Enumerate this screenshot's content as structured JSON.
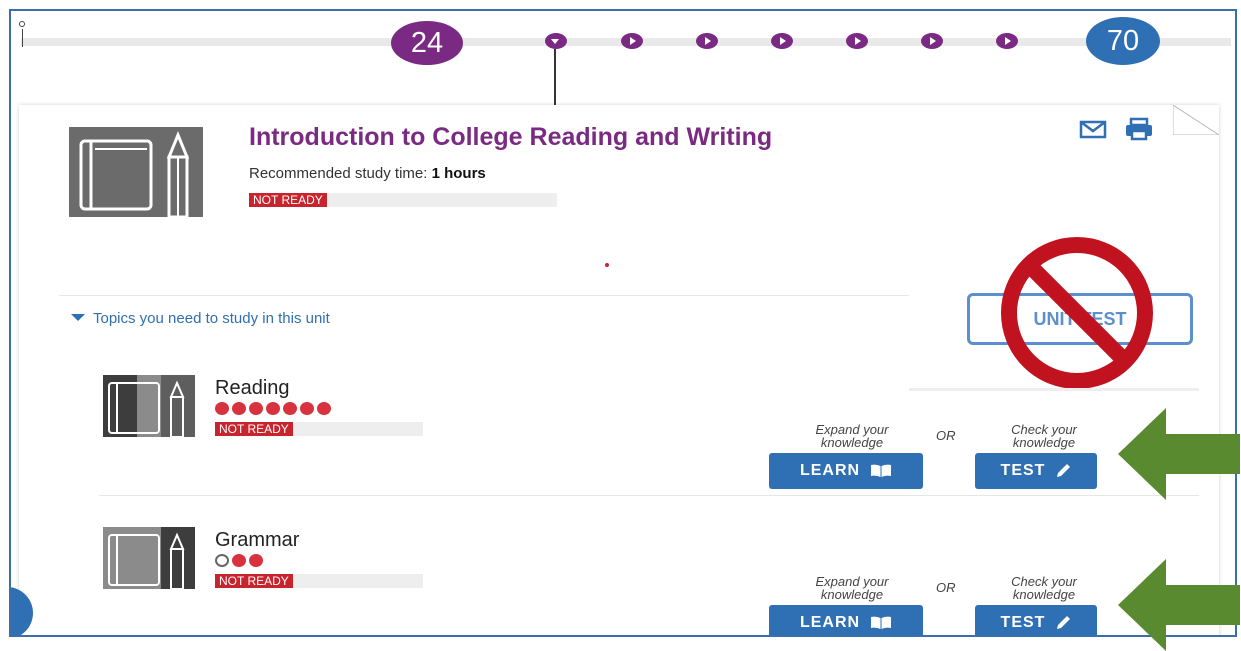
{
  "timeline": {
    "start_node": "24",
    "end_node": "70"
  },
  "unit": {
    "title": "Introduction to College Reading and Writing",
    "study_label": "Recommended study time:",
    "study_value": "1 hours",
    "status": "NOT READY"
  },
  "unit_test": {
    "label": "UNIT TEST",
    "blocked_icon": "prohibited-icon"
  },
  "topics_header": "Topics you need to study in this unit",
  "topics": [
    {
      "name": "Reading",
      "status": "NOT READY",
      "dots_filled": 7,
      "dots_total": 7,
      "learn_hint": "Expand your knowledge",
      "or": "OR",
      "test_hint": "Check your knowledge",
      "learn_label": "LEARN",
      "test_label": "TEST"
    },
    {
      "name": "Grammar",
      "status": "NOT READY",
      "dots_filled": 2,
      "dots_total": 3,
      "learn_hint": "Expand your knowledge",
      "or": "OR",
      "test_hint": "Check your knowledge",
      "learn_label": "LEARN",
      "test_label": "TEST"
    }
  ],
  "colors": {
    "brand_purple": "#7b2a83",
    "brand_blue": "#2f6fb4",
    "not_ready_red": "#c8242e",
    "annotation_green": "#5a8a2f",
    "prohibited_red": "#c1121f"
  }
}
